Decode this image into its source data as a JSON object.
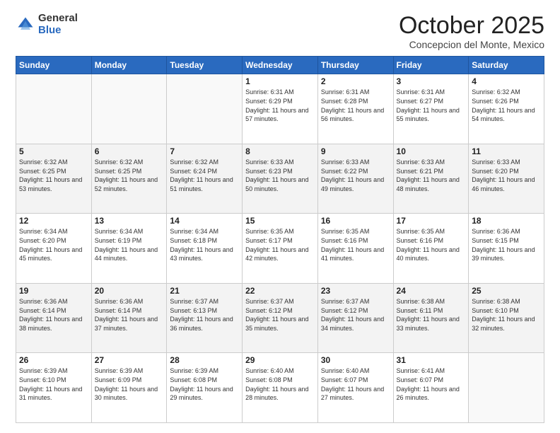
{
  "logo": {
    "general": "General",
    "blue": "Blue"
  },
  "header": {
    "month": "October 2025",
    "location": "Concepcion del Monte, Mexico"
  },
  "days_of_week": [
    "Sunday",
    "Monday",
    "Tuesday",
    "Wednesday",
    "Thursday",
    "Friday",
    "Saturday"
  ],
  "weeks": [
    [
      {
        "day": "",
        "info": ""
      },
      {
        "day": "",
        "info": ""
      },
      {
        "day": "",
        "info": ""
      },
      {
        "day": "1",
        "info": "Sunrise: 6:31 AM\nSunset: 6:29 PM\nDaylight: 11 hours\nand 57 minutes."
      },
      {
        "day": "2",
        "info": "Sunrise: 6:31 AM\nSunset: 6:28 PM\nDaylight: 11 hours\nand 56 minutes."
      },
      {
        "day": "3",
        "info": "Sunrise: 6:31 AM\nSunset: 6:27 PM\nDaylight: 11 hours\nand 55 minutes."
      },
      {
        "day": "4",
        "info": "Sunrise: 6:32 AM\nSunset: 6:26 PM\nDaylight: 11 hours\nand 54 minutes."
      }
    ],
    [
      {
        "day": "5",
        "info": "Sunrise: 6:32 AM\nSunset: 6:25 PM\nDaylight: 11 hours\nand 53 minutes."
      },
      {
        "day": "6",
        "info": "Sunrise: 6:32 AM\nSunset: 6:25 PM\nDaylight: 11 hours\nand 52 minutes."
      },
      {
        "day": "7",
        "info": "Sunrise: 6:32 AM\nSunset: 6:24 PM\nDaylight: 11 hours\nand 51 minutes."
      },
      {
        "day": "8",
        "info": "Sunrise: 6:33 AM\nSunset: 6:23 PM\nDaylight: 11 hours\nand 50 minutes."
      },
      {
        "day": "9",
        "info": "Sunrise: 6:33 AM\nSunset: 6:22 PM\nDaylight: 11 hours\nand 49 minutes."
      },
      {
        "day": "10",
        "info": "Sunrise: 6:33 AM\nSunset: 6:21 PM\nDaylight: 11 hours\nand 48 minutes."
      },
      {
        "day": "11",
        "info": "Sunrise: 6:33 AM\nSunset: 6:20 PM\nDaylight: 11 hours\nand 46 minutes."
      }
    ],
    [
      {
        "day": "12",
        "info": "Sunrise: 6:34 AM\nSunset: 6:20 PM\nDaylight: 11 hours\nand 45 minutes."
      },
      {
        "day": "13",
        "info": "Sunrise: 6:34 AM\nSunset: 6:19 PM\nDaylight: 11 hours\nand 44 minutes."
      },
      {
        "day": "14",
        "info": "Sunrise: 6:34 AM\nSunset: 6:18 PM\nDaylight: 11 hours\nand 43 minutes."
      },
      {
        "day": "15",
        "info": "Sunrise: 6:35 AM\nSunset: 6:17 PM\nDaylight: 11 hours\nand 42 minutes."
      },
      {
        "day": "16",
        "info": "Sunrise: 6:35 AM\nSunset: 6:16 PM\nDaylight: 11 hours\nand 41 minutes."
      },
      {
        "day": "17",
        "info": "Sunrise: 6:35 AM\nSunset: 6:16 PM\nDaylight: 11 hours\nand 40 minutes."
      },
      {
        "day": "18",
        "info": "Sunrise: 6:36 AM\nSunset: 6:15 PM\nDaylight: 11 hours\nand 39 minutes."
      }
    ],
    [
      {
        "day": "19",
        "info": "Sunrise: 6:36 AM\nSunset: 6:14 PM\nDaylight: 11 hours\nand 38 minutes."
      },
      {
        "day": "20",
        "info": "Sunrise: 6:36 AM\nSunset: 6:14 PM\nDaylight: 11 hours\nand 37 minutes."
      },
      {
        "day": "21",
        "info": "Sunrise: 6:37 AM\nSunset: 6:13 PM\nDaylight: 11 hours\nand 36 minutes."
      },
      {
        "day": "22",
        "info": "Sunrise: 6:37 AM\nSunset: 6:12 PM\nDaylight: 11 hours\nand 35 minutes."
      },
      {
        "day": "23",
        "info": "Sunrise: 6:37 AM\nSunset: 6:12 PM\nDaylight: 11 hours\nand 34 minutes."
      },
      {
        "day": "24",
        "info": "Sunrise: 6:38 AM\nSunset: 6:11 PM\nDaylight: 11 hours\nand 33 minutes."
      },
      {
        "day": "25",
        "info": "Sunrise: 6:38 AM\nSunset: 6:10 PM\nDaylight: 11 hours\nand 32 minutes."
      }
    ],
    [
      {
        "day": "26",
        "info": "Sunrise: 6:39 AM\nSunset: 6:10 PM\nDaylight: 11 hours\nand 31 minutes."
      },
      {
        "day": "27",
        "info": "Sunrise: 6:39 AM\nSunset: 6:09 PM\nDaylight: 11 hours\nand 30 minutes."
      },
      {
        "day": "28",
        "info": "Sunrise: 6:39 AM\nSunset: 6:08 PM\nDaylight: 11 hours\nand 29 minutes."
      },
      {
        "day": "29",
        "info": "Sunrise: 6:40 AM\nSunset: 6:08 PM\nDaylight: 11 hours\nand 28 minutes."
      },
      {
        "day": "30",
        "info": "Sunrise: 6:40 AM\nSunset: 6:07 PM\nDaylight: 11 hours\nand 27 minutes."
      },
      {
        "day": "31",
        "info": "Sunrise: 6:41 AM\nSunset: 6:07 PM\nDaylight: 11 hours\nand 26 minutes."
      },
      {
        "day": "",
        "info": ""
      }
    ]
  ]
}
